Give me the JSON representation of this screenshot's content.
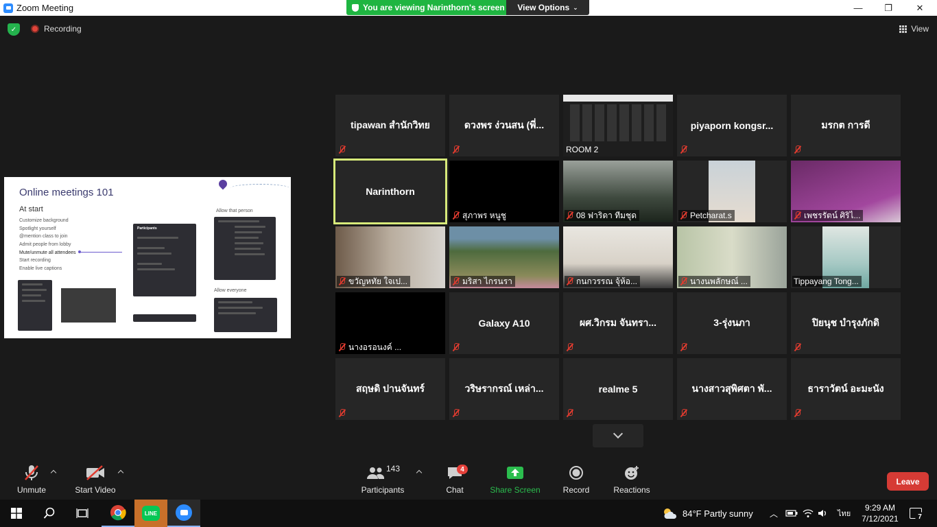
{
  "window": {
    "title": "Zoom Meeting",
    "minimize": "—",
    "maximize": "❐",
    "close": "✕"
  },
  "share_banner": {
    "text": "You are viewing Narinthorn's screen",
    "view_options": "View Options"
  },
  "topbar": {
    "recording": "Recording",
    "view": "View"
  },
  "shared_screen": {
    "title": "Online meetings 101",
    "at_start": "At start",
    "items": [
      "Customize background",
      "Spotlight yourself",
      "@mention class to join",
      "Admit people from lobby",
      "Mute/unmute all attendees",
      "Start recording",
      "Enable live captions"
    ],
    "allow_that_person": "Allow that person",
    "allow_everyone": "Allow everyone",
    "participants_label": "Participants"
  },
  "tiles": [
    {
      "name": "tipawan สำนักวิทย",
      "label": ""
    },
    {
      "name": "ดวงพร ง่วนสน (พี่...",
      "label": ""
    },
    {
      "name": "",
      "label": "ROOM 2"
    },
    {
      "name": "piyaporn  kongsr...",
      "label": ""
    },
    {
      "name": "มรกต การดี",
      "label": ""
    },
    {
      "name": "Narinthorn",
      "label": ""
    },
    {
      "name": "",
      "label": "สุภาพร  หนูชู"
    },
    {
      "name": "",
      "label": "08 ฟาริดา ทีมชุด"
    },
    {
      "name": "",
      "label": "Petcharat.s"
    },
    {
      "name": "",
      "label": "เพชรรัตน์ ศิริไ..."
    },
    {
      "name": "",
      "label": "ขวัญหทัย  ใจเป..."
    },
    {
      "name": "",
      "label": "มริสา ไกรนรา"
    },
    {
      "name": "",
      "label": "กนกวรรณ จุ้ห้อ..."
    },
    {
      "name": "",
      "label": "นางนพลักษณ์  ..."
    },
    {
      "name": "",
      "label": "Tippayang Tong..."
    },
    {
      "name": "",
      "label": "นางอรอนงค์   ..."
    },
    {
      "name": "Galaxy A10",
      "label": ""
    },
    {
      "name": "ผศ.วิกรม จันทรา...",
      "label": ""
    },
    {
      "name": "3-รุ่งนภา",
      "label": ""
    },
    {
      "name": "ปิยนุช  บำรุงภักดิ",
      "label": ""
    },
    {
      "name": "สฤษดิ ปานจันทร์",
      "label": ""
    },
    {
      "name": "วริษรากรณ์ เหล่า...",
      "label": ""
    },
    {
      "name": "realme 5",
      "label": ""
    },
    {
      "name": "นางสาวสุพิศตา พั...",
      "label": ""
    },
    {
      "name": "ธาราวัตน์ อะมะนัง",
      "label": ""
    }
  ],
  "toolbar": {
    "unmute": "Unmute",
    "start_video": "Start Video",
    "participants": "Participants",
    "participants_count": "143",
    "chat": "Chat",
    "chat_badge": "4",
    "share_screen": "Share Screen",
    "record": "Record",
    "reactions": "Reactions",
    "leave": "Leave"
  },
  "taskbar": {
    "weather": "84°F  Partly sunny",
    "lang": "ไทย",
    "time": "9:29 AM",
    "date": "7/12/2021",
    "notifications": "7"
  },
  "colors": {
    "share_green": "#1fb541",
    "leave_red": "#d63b35",
    "mute_red": "#e03b2f",
    "active_speaker": "#d7ea7a"
  }
}
